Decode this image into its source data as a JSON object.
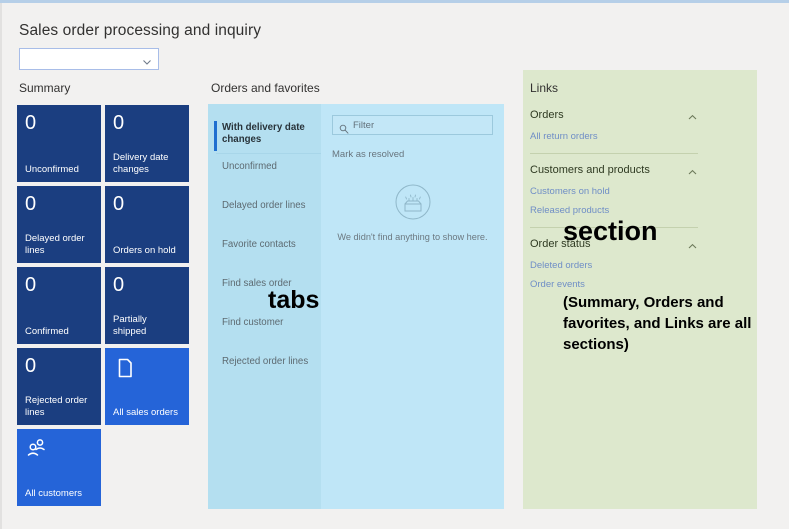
{
  "page": {
    "title": "Sales order processing and inquiry"
  },
  "view_selector": {
    "value": "",
    "placeholder": "",
    "chevron_icon": "chevron-down-icon"
  },
  "summary": {
    "header": "Summary",
    "tiles": [
      {
        "count": "0",
        "label": "Unconfirmed",
        "type": "count"
      },
      {
        "count": "0",
        "label": "Delivery date changes",
        "type": "count"
      },
      {
        "count": "0",
        "label": "Delayed order lines",
        "type": "count"
      },
      {
        "count": "0",
        "label": "Orders on hold",
        "type": "count"
      },
      {
        "count": "0",
        "label": "Confirmed",
        "type": "count"
      },
      {
        "count": "0",
        "label": "Partially shipped",
        "type": "count"
      },
      {
        "count": "0",
        "label": "Rejected order lines",
        "type": "count"
      },
      {
        "icon": "document-icon",
        "label": "All sales orders",
        "type": "action"
      },
      {
        "icon": "people-icon",
        "label": "All customers",
        "type": "action"
      }
    ]
  },
  "orders_and_favorites": {
    "header": "Orders and favorites",
    "tabs": [
      {
        "label": "With delivery date changes",
        "active": true
      },
      {
        "label": "Unconfirmed",
        "active": false
      },
      {
        "label": "Delayed order lines",
        "active": false
      },
      {
        "label": "Favorite contacts",
        "active": false
      },
      {
        "label": "Find sales order",
        "active": false
      },
      {
        "label": "Find customer",
        "active": false
      },
      {
        "label": "Rejected order lines",
        "active": false
      }
    ],
    "filter": {
      "placeholder": "Filter",
      "value": "",
      "icon": "search-icon"
    },
    "command": "Mark as resolved",
    "empty_state": {
      "icon": "empty-box-icon",
      "message": "We didn't find anything to show here."
    }
  },
  "links": {
    "header": "Links",
    "groups": [
      {
        "title": "Orders",
        "chevron_icon": "chevron-up-icon",
        "items": [
          "All return orders"
        ]
      },
      {
        "title": "Customers and products",
        "chevron_icon": "chevron-up-icon",
        "items": [
          "Customers on hold",
          "Released products"
        ]
      },
      {
        "title": "Order status",
        "chevron_icon": "chevron-up-icon",
        "items": [
          "Deleted orders",
          "Order events"
        ]
      }
    ]
  },
  "annotations": {
    "tabs_label": "tabs",
    "section_label": "section",
    "sections_note": "(Summary, Orders and favorites, and Links are all sections)"
  },
  "colors": {
    "page_background": "#f2f1f0",
    "tile_count": "#1b3e80",
    "tile_action": "#2564d8",
    "orders_panel": "#bfe6f7",
    "orders_tabs": "#b4dff0",
    "links_panel": "#dde8cd",
    "link_text": "#6f8ec6",
    "top_accent": "#b6cfe8"
  }
}
